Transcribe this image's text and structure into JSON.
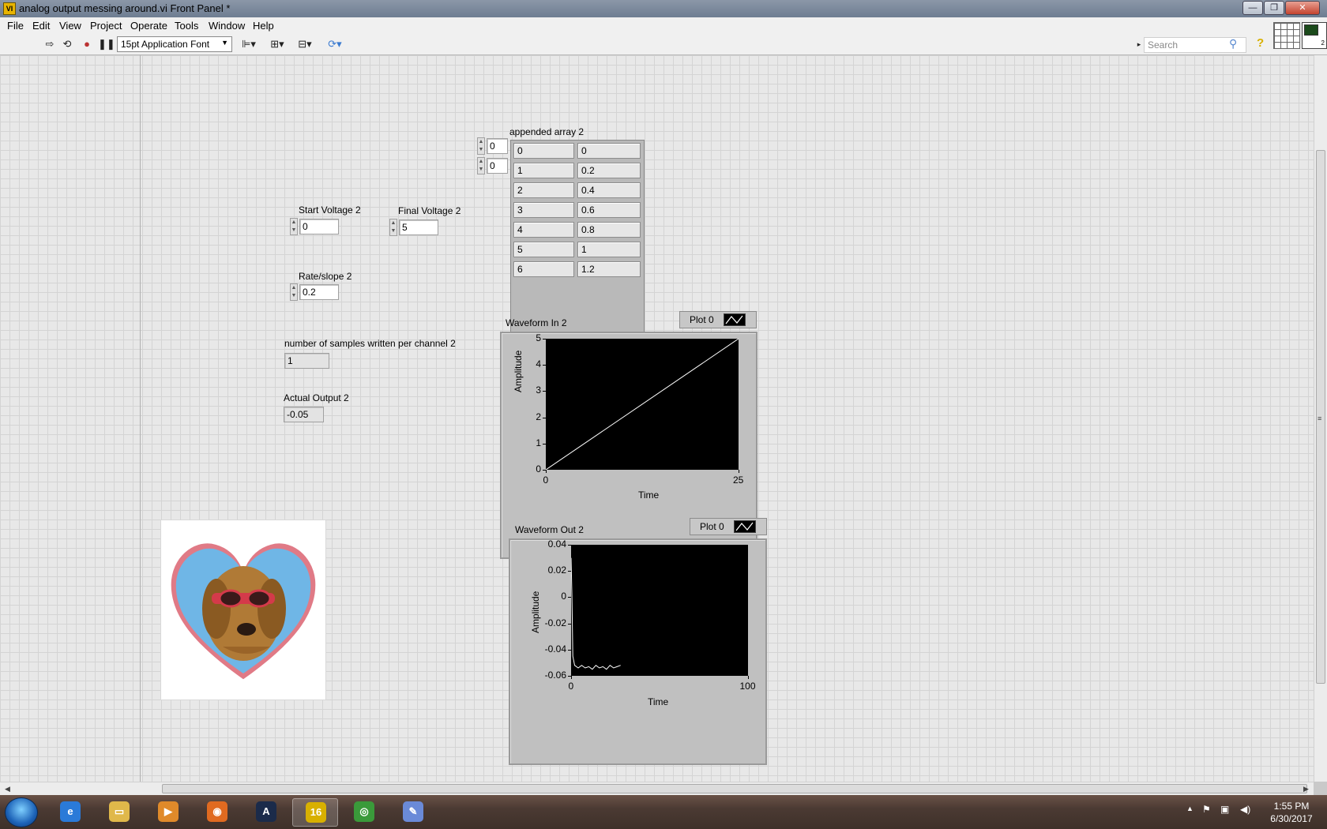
{
  "window": {
    "title": "analog output messing around.vi Front Panel *",
    "app_icon_text": "VI"
  },
  "menu": [
    "File",
    "Edit",
    "View",
    "Project",
    "Operate",
    "Tools",
    "Window",
    "Help"
  ],
  "toolbar": {
    "font_select": "15pt Application Font",
    "search_placeholder": "Search",
    "help_glyph": "?"
  },
  "controls": {
    "start_voltage": {
      "label": "Start Voltage 2",
      "value": "0"
    },
    "final_voltage": {
      "label": "Final Voltage 2",
      "value": "5"
    },
    "rate_slope": {
      "label": "Rate/slope 2",
      "value": "0.2"
    },
    "samples_written": {
      "label": "number of samples written per channel 2",
      "value": "1"
    },
    "actual_output": {
      "label": "Actual Output 2",
      "value": "-0.05"
    }
  },
  "array": {
    "label": "appended array 2",
    "index0": "0",
    "index1": "0",
    "rows": [
      [
        "0",
        "0"
      ],
      [
        "1",
        "0.2"
      ],
      [
        "2",
        "0.4"
      ],
      [
        "3",
        "0.6"
      ],
      [
        "4",
        "0.8"
      ],
      [
        "5",
        "1"
      ],
      [
        "6",
        "1.2"
      ]
    ]
  },
  "chart_data": [
    {
      "type": "line",
      "title": "Waveform In 2",
      "xlabel": "Time",
      "ylabel": "Amplitude",
      "legend": "Plot 0",
      "xlim": [
        0,
        25
      ],
      "ylim": [
        0,
        5
      ],
      "xticks": [
        "0",
        "25"
      ],
      "yticks": [
        "0",
        "1",
        "2",
        "3",
        "4",
        "5"
      ],
      "series": [
        {
          "name": "Plot 0",
          "x": [
            0,
            25
          ],
          "y": [
            0,
            5
          ]
        }
      ]
    },
    {
      "type": "line",
      "title": "Waveform Out 2",
      "xlabel": "Time",
      "ylabel": "Amplitude",
      "legend": "Plot 0",
      "xlim": [
        0,
        100
      ],
      "ylim": [
        -0.06,
        0.04
      ],
      "xticks": [
        "0",
        "100"
      ],
      "yticks": [
        "0.04",
        "0.02",
        "0",
        "-0.02",
        "-0.04",
        "-0.06"
      ],
      "series": [
        {
          "name": "Plot 0",
          "x": [
            0,
            0.5,
            1,
            2,
            4,
            6,
            8,
            10,
            12,
            14,
            16,
            18,
            20,
            22,
            24,
            26,
            28
          ],
          "y": [
            0.03,
            0.0,
            -0.045,
            -0.052,
            -0.054,
            -0.052,
            -0.054,
            -0.053,
            -0.055,
            -0.052,
            -0.054,
            -0.053,
            -0.055,
            -0.052,
            -0.054,
            -0.053,
            -0.052
          ]
        }
      ]
    }
  ],
  "taskbar": {
    "apps": [
      {
        "name": "internet-explorer",
        "glyph": "e",
        "color": "#2a7ad8"
      },
      {
        "name": "file-explorer",
        "glyph": "▭",
        "color": "#e0b84a"
      },
      {
        "name": "media-player",
        "glyph": "▶",
        "color": "#e08a2a"
      },
      {
        "name": "firefox",
        "glyph": "◉",
        "color": "#e06a20"
      },
      {
        "name": "acrobat",
        "glyph": "A",
        "color": "#1b2b4a"
      },
      {
        "name": "labview",
        "glyph": "16",
        "color": "#d8b000"
      },
      {
        "name": "chrome",
        "glyph": "◎",
        "color": "#3a9a3a"
      },
      {
        "name": "paint",
        "glyph": "✎",
        "color": "#6a8ad8"
      }
    ],
    "time": "1:55 PM",
    "date": "6/30/2017"
  }
}
